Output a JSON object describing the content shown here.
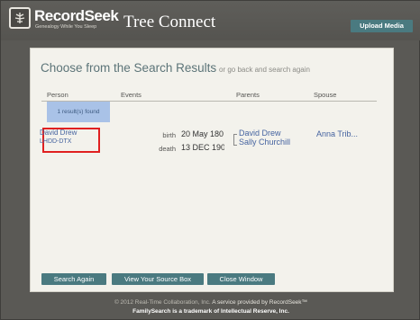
{
  "header": {
    "brand_name": "RecordSeek",
    "brand_tagline": "Genealogy While You Sleep",
    "app_title": "Tree Connect",
    "upload_label": "Upload Media",
    "logo_icon": "tree-logo-icon"
  },
  "panel": {
    "title": "Choose from the Search Results",
    "subtitle": "or go back and search again",
    "columns": {
      "person": "Person",
      "events": "Events",
      "parents": "Parents",
      "spouse": "Spouse"
    },
    "results_count": "1 result(s) found",
    "result": {
      "person_name": "David Drew",
      "person_id": "LHDD-DTX",
      "birth_label": "birth",
      "birth_date": "20 May 180",
      "death_label": "death",
      "death_date": "13 DEC 190",
      "father": "David Drew",
      "mother": "Sally Churchill",
      "spouse": "Anna Trib..."
    },
    "buttons": {
      "search_again": "Search Again",
      "view_source_box": "View Your Source Box",
      "close_window": "Close Window"
    }
  },
  "footer": {
    "copyright": "© 2012 Real-Time Collaboration, Inc.",
    "service_text": "A service provided by RecordSeek™",
    "trademark": "FamilySearch is a trademark of Intellectual Reserve, Inc."
  },
  "colors": {
    "background": "#5a5955",
    "panel": "#f3f2ec",
    "button": "#4a7a80",
    "link": "#4664a0",
    "highlight_border": "#e02020",
    "results_badge": "#a9c2e7"
  }
}
